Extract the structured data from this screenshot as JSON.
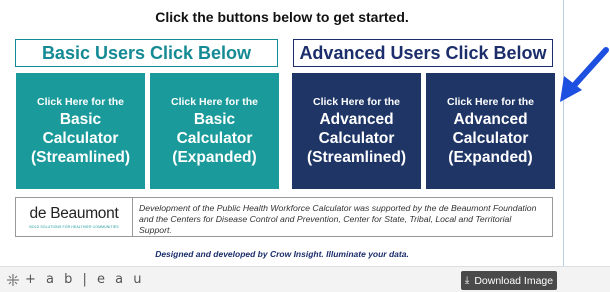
{
  "header": {
    "title": "Click the buttons below to get started."
  },
  "sections": {
    "basic": {
      "title": "Basic Users Click Below"
    },
    "advanced": {
      "title": "Advanced Users Click Below"
    }
  },
  "buttons": [
    {
      "pre": "Click Here for the",
      "line1": "Basic",
      "line2": "Calculator",
      "line3": "(Streamlined)"
    },
    {
      "pre": "Click Here for the",
      "line1": "Basic",
      "line2": "Calculator",
      "line3": "(Expanded)"
    },
    {
      "pre": "Click Here for the",
      "line1": "Advanced",
      "line2": "Calculator",
      "line3": "(Streamlined)"
    },
    {
      "pre": "Click Here for the",
      "line1": "Advanced",
      "line2": "Calculator",
      "line3": "(Expanded)"
    }
  ],
  "credits": {
    "logo_text": "de Beaumont",
    "logo_tagline": "BOLD SOLUTIONS FOR HEALTHIER COMMUNITIES",
    "text": "Development of the Public Health Workforce Calculator was supported by the de Beaumont Foundation and the Centers for Disease Control and Prevention, Center for State, Tribal, Local and Territorial Support."
  },
  "footer": {
    "designed": "Designed and developed by Crow Insight. Illuminate your data."
  },
  "toolbar": {
    "brand": "+ a b | e a u",
    "download_label": "Download Image",
    "download_icon": "⤓"
  },
  "colors": {
    "teal": "#1a9a9a",
    "navy": "#1e3566",
    "arrow": "#1d4fe0"
  }
}
